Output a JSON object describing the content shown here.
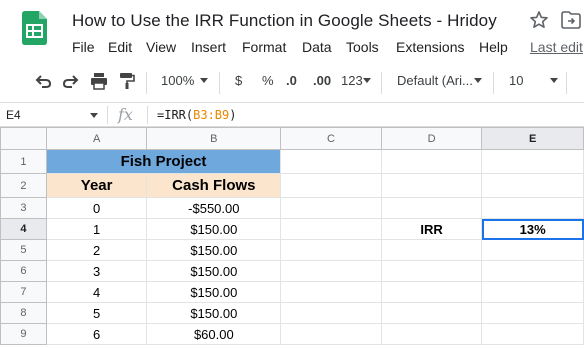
{
  "document": {
    "title": "How to Use the IRR Function in Google Sheets - Hridoy",
    "last_edit": "Last edit"
  },
  "menu": [
    "File",
    "Edit",
    "View",
    "Insert",
    "Format",
    "Data",
    "Tools",
    "Extensions",
    "Help"
  ],
  "toolbar": {
    "zoom": "100%",
    "currency": "$",
    "percent": "%",
    "decrease_decimal": ".0",
    "increase_decimal": ".00",
    "more_formats": "123",
    "font": "Default (Ari...",
    "font_size": "10"
  },
  "formula_bar": {
    "cell_ref": "E4",
    "fx": "fx",
    "formula_prefix": "=IRR(",
    "formula_range": "B3:B9",
    "formula_suffix": ")"
  },
  "columns": [
    "A",
    "B",
    "C",
    "D",
    "E"
  ],
  "rows": [
    "1",
    "2",
    "3",
    "4",
    "5",
    "6",
    "7",
    "8",
    "9"
  ],
  "sheet": {
    "title": "Fish Project",
    "year_header": "Year",
    "cash_header": "Cash Flows",
    "years": [
      "0",
      "1",
      "2",
      "3",
      "4",
      "5",
      "6"
    ],
    "cash_flows": [
      "-$550.00",
      "$150.00",
      "$150.00",
      "$150.00",
      "$150.00",
      "$150.00",
      "$60.00"
    ],
    "irr_label": "IRR",
    "irr_value": "13%"
  },
  "colors": {
    "title_fill": "#6fa8dc",
    "header_fill": "#fce5cd",
    "selection": "#1a73e8",
    "sheets_green": "#0f9d58"
  }
}
